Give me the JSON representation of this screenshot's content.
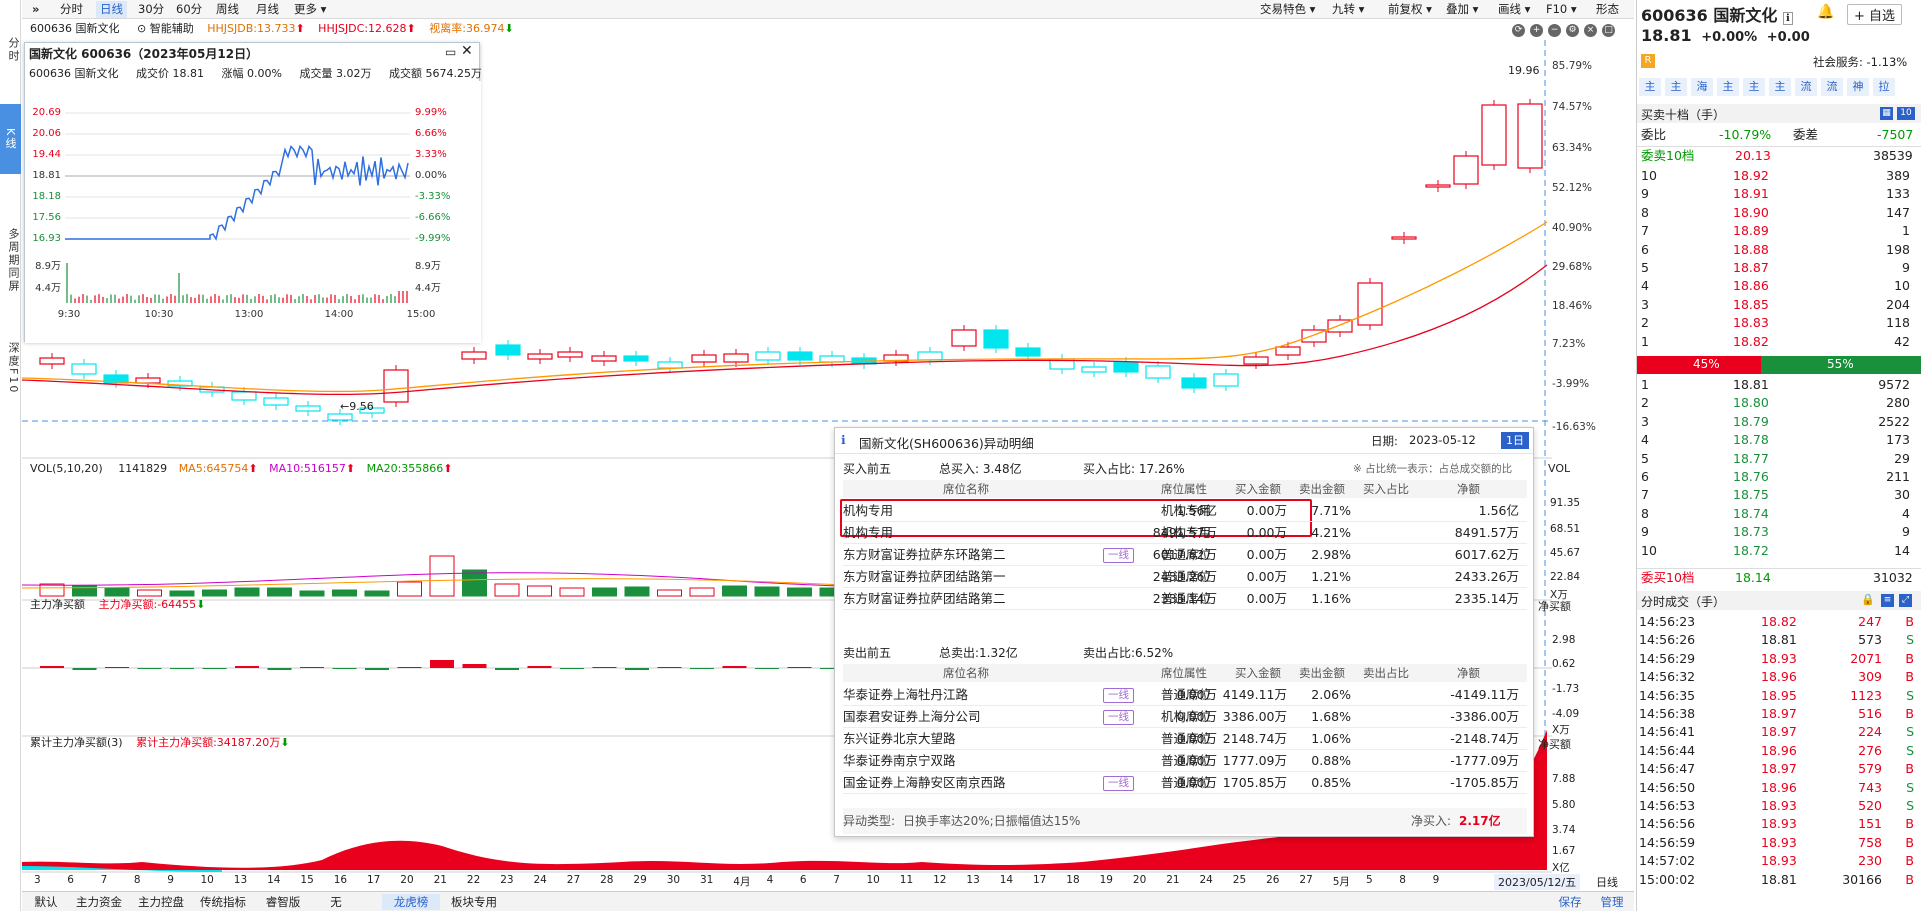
{
  "leftbar": {
    "items": [
      "分时",
      "K线",
      "多周期同屏",
      "深度F10"
    ]
  },
  "toolbar": {
    "menu_icon": "»",
    "tabs": [
      "分时",
      "日线",
      "30分",
      "60分",
      "周线",
      "月线",
      "更多"
    ],
    "right_items": [
      "交易特色",
      "九转",
      "前复权",
      "叠加",
      "画线",
      "F10",
      "形态"
    ]
  },
  "indicator_line": {
    "code": "600636",
    "name": "国新文化",
    "assist": "智能辅助",
    "hhjsjdb": "HHJSJDB:13.733",
    "hhjsjdc": "HHJSJDC:12.628",
    "ratio": "视离率:36.974"
  },
  "price_axis": [
    "85.79%",
    "74.57%",
    "63.34%",
    "52.12%",
    "40.90%",
    "29.68%",
    "18.46%",
    "7.23%",
    "-3.99%",
    "-16.63%"
  ],
  "chart_labels": {
    "high": "19.96",
    "low": "9.56",
    "icon_r": "R",
    "icon_5": "5"
  },
  "vol": {
    "header": "VOL(5,10,20)",
    "value": "1141829",
    "ma5": "MA5:645754",
    "ma10": "MA10:516157",
    "ma20": "MA20:355866",
    "tag": "VOL",
    "axis": [
      "91.35",
      "68.51",
      "45.67",
      "22.84",
      "X万"
    ]
  },
  "main_flow": {
    "header": "主力净买额",
    "value": "主力净买额:-64455",
    "tag": "净买额",
    "axis": [
      "2.98",
      "0.62",
      "-1.73",
      "-4.09",
      "X万"
    ]
  },
  "cum_flow": {
    "header": "累计主力净买额(3)",
    "value": "累计主力净买额:34187.20万",
    "tag": "净买额",
    "axis": [
      "7.88",
      "5.80",
      "3.74",
      "1.67",
      "X亿"
    ]
  },
  "date_axis": [
    "3",
    "6",
    "7",
    "8",
    "9",
    "10",
    "13",
    "14",
    "15",
    "16",
    "17",
    "20",
    "21",
    "22",
    "23",
    "24",
    "27",
    "28",
    "29",
    "30",
    "31",
    "4月",
    "4",
    "6",
    "7",
    "10",
    "11",
    "12",
    "13",
    "14",
    "17",
    "18",
    "19",
    "20",
    "21",
    "24",
    "25",
    "26",
    "27",
    "5月",
    "5",
    "8",
    "9"
  ],
  "date_axis_current": "2023/05/12/五",
  "date_axis_mode": "日线",
  "bottom_tabs": [
    "默认",
    "主力资金",
    "主力控盘",
    "传统指标",
    "睿智版",
    "无",
    "龙虎榜",
    "板块专用"
  ],
  "bottom_right": [
    "保存",
    "管理"
  ],
  "mini": {
    "title": "国新文化 600636（2023年05月12日）",
    "info_code": "600636 国新文化",
    "info_price": "成交价 18.81",
    "info_change": "涨幅 0.00%",
    "info_volume": "成交量 3.02万",
    "info_amount": "成交额 5674.25万",
    "left_axis": [
      "20.69",
      "20.06",
      "19.44",
      "18.81",
      "18.18",
      "17.56",
      "16.93"
    ],
    "right_axis": [
      "9.99%",
      "6.66%",
      "3.33%",
      "0.00%",
      "-3.33%",
      "-6.66%",
      "-9.99%"
    ],
    "vol_axis": [
      "8.9万",
      "4.4万"
    ],
    "time_axis": [
      "9:30",
      "10:30",
      "13:00",
      "14:00",
      "15:00"
    ],
    "line_color": "#2f6fe0"
  },
  "popup": {
    "title": "国新文化(SH600636)异动明细",
    "date_label": "日期:",
    "date": "2023-05-12",
    "period_btn": "1日",
    "buy_section": "买入前五",
    "buy_total": "总买入: 3.48亿",
    "buy_ratio": "买入占比: 17.26%",
    "note": "※ 占比统一表示：占总成交额的比",
    "columns": [
      "席位名称",
      "席位属性",
      "买入金额",
      "卖出金额",
      "买入占比",
      "净额"
    ],
    "buy_rows": [
      {
        "name": "机构专用",
        "tag": "",
        "attr": "机构专用",
        "buy": "1.56亿",
        "sell": "0.00万",
        "ratio": "7.71%",
        "net": "1.56亿"
      },
      {
        "name": "机构专用",
        "tag": "",
        "attr": "机构专用",
        "buy": "8491.57万",
        "sell": "0.00万",
        "ratio": "4.21%",
        "net": "8491.57万"
      },
      {
        "name": "东方财富证券拉萨东环路第二",
        "tag": "一线",
        "attr": "普通席位",
        "buy": "6017.62万",
        "sell": "0.00万",
        "ratio": "2.98%",
        "net": "6017.62万"
      },
      {
        "name": "东方财富证券拉萨团结路第一",
        "tag": "",
        "attr": "普通席位",
        "buy": "2433.26万",
        "sell": "0.00万",
        "ratio": "1.21%",
        "net": "2433.26万"
      },
      {
        "name": "东方财富证券拉萨团结路第二",
        "tag": "",
        "attr": "普通席位",
        "buy": "2335.14万",
        "sell": "0.00万",
        "ratio": "1.16%",
        "net": "2335.14万"
      }
    ],
    "sell_section": "卖出前五",
    "sell_total": "总卖出:1.32亿",
    "sell_ratio": "卖出占比:6.52%",
    "sell_columns": [
      "席位名称",
      "席位属性",
      "买入金额",
      "卖出金额",
      "卖出占比",
      "净额"
    ],
    "sell_rows": [
      {
        "name": "华泰证券上海牡丹江路",
        "tag": "一线",
        "attr": "普通席位",
        "buy": "0.00万",
        "sell": "4149.11万",
        "ratio": "2.06%",
        "net": "-4149.11万"
      },
      {
        "name": "国泰君安证券上海分公司",
        "tag": "一线",
        "attr": "机构席位",
        "buy": "0.00万",
        "sell": "3386.00万",
        "ratio": "1.68%",
        "net": "-3386.00万"
      },
      {
        "name": "东兴证券北京大望路",
        "tag": "",
        "attr": "普通席位",
        "buy": "0.00万",
        "sell": "2148.74万",
        "ratio": "1.06%",
        "net": "-2148.74万"
      },
      {
        "name": "华泰证券南京宁双路",
        "tag": "",
        "attr": "普通席位",
        "buy": "0.00万",
        "sell": "1777.09万",
        "ratio": "0.88%",
        "net": "-1777.09万"
      },
      {
        "name": "国金证券上海静安区南京西路",
        "tag": "一线",
        "attr": "普通席位",
        "buy": "0.00万",
        "sell": "1705.85万",
        "ratio": "0.85%",
        "net": "-1705.85万"
      }
    ],
    "footer_type_label": "异动类型:",
    "footer_type": "日换手率达20%;日振幅值达15%",
    "footer_net_label": "净买入:",
    "footer_net": "2.17亿"
  },
  "right_panel": {
    "code": "600636",
    "name": "国新文化",
    "price": "18.81",
    "change": "+0.00%",
    "change_abs": "+0.00",
    "add_btn": "+ 自选",
    "r_badge": "R",
    "industry": "社会服务: -1.13%",
    "tags": [
      "主",
      "主",
      "海",
      "主",
      "主",
      "主",
      "流",
      "流",
      "神",
      "拉"
    ],
    "book_title": "买卖十档（手）",
    "book_btn": "10",
    "weibi_label": "委比",
    "weibi": "-10.79%",
    "weicha_label": "委差",
    "weicha": "-7507",
    "ask_sum_label": "委卖10档",
    "ask_sum_price": "20.13",
    "ask_sum_vol": "38539",
    "asks": [
      {
        "lvl": "10",
        "price": "18.92",
        "vol": "389"
      },
      {
        "lvl": "9",
        "price": "18.91",
        "vol": "133"
      },
      {
        "lvl": "8",
        "price": "18.90",
        "vol": "147"
      },
      {
        "lvl": "7",
        "price": "18.89",
        "vol": "1"
      },
      {
        "lvl": "6",
        "price": "18.88",
        "vol": "198"
      },
      {
        "lvl": "5",
        "price": "18.87",
        "vol": "9"
      },
      {
        "lvl": "4",
        "price": "18.86",
        "vol": "10"
      },
      {
        "lvl": "3",
        "price": "18.85",
        "vol": "204"
      },
      {
        "lvl": "2",
        "price": "18.83",
        "vol": "118"
      },
      {
        "lvl": "1",
        "price": "18.82",
        "vol": "42"
      }
    ],
    "bar_sell": "45%",
    "bar_buy": "55%",
    "bids": [
      {
        "lvl": "1",
        "price": "18.81",
        "vol": "9572"
      },
      {
        "lvl": "2",
        "price": "18.80",
        "vol": "280"
      },
      {
        "lvl": "3",
        "price": "18.79",
        "vol": "2522"
      },
      {
        "lvl": "4",
        "price": "18.78",
        "vol": "173"
      },
      {
        "lvl": "5",
        "price": "18.77",
        "vol": "29"
      },
      {
        "lvl": "6",
        "price": "18.76",
        "vol": "211"
      },
      {
        "lvl": "7",
        "price": "18.75",
        "vol": "30"
      },
      {
        "lvl": "8",
        "price": "18.74",
        "vol": "4"
      },
      {
        "lvl": "9",
        "price": "18.73",
        "vol": "9"
      },
      {
        "lvl": "10",
        "price": "18.72",
        "vol": "14"
      }
    ],
    "bid_sum_label": "委买10档",
    "bid_sum_price": "18.14",
    "bid_sum_vol": "31032",
    "ticks_title": "分时成交（手）",
    "ticks": [
      {
        "time": "14:56:23",
        "price": "18.82",
        "vol": "247",
        "side": "B",
        "color": "red"
      },
      {
        "time": "14:56:26",
        "price": "18.81",
        "vol": "573",
        "side": "S",
        "color": "black"
      },
      {
        "time": "14:56:29",
        "price": "18.93",
        "vol": "2071",
        "side": "B",
        "color": "red"
      },
      {
        "time": "14:56:32",
        "price": "18.96",
        "vol": "309",
        "side": "B",
        "color": "red"
      },
      {
        "time": "14:56:35",
        "price": "18.95",
        "vol": "1123",
        "side": "S",
        "color": "red"
      },
      {
        "time": "14:56:38",
        "price": "18.97",
        "vol": "516",
        "side": "B",
        "color": "red"
      },
      {
        "time": "14:56:41",
        "price": "18.97",
        "vol": "224",
        "side": "S",
        "color": "red"
      },
      {
        "time": "14:56:44",
        "price": "18.96",
        "vol": "276",
        "side": "S",
        "color": "red"
      },
      {
        "time": "14:56:47",
        "price": "18.97",
        "vol": "579",
        "side": "B",
        "color": "red"
      },
      {
        "time": "14:56:50",
        "price": "18.96",
        "vol": "743",
        "side": "S",
        "color": "red"
      },
      {
        "time": "14:56:53",
        "price": "18.93",
        "vol": "520",
        "side": "S",
        "color": "red"
      },
      {
        "time": "14:56:56",
        "price": "18.93",
        "vol": "151",
        "side": "B",
        "color": "red"
      },
      {
        "time": "14:56:59",
        "price": "18.93",
        "vol": "758",
        "side": "B",
        "color": "red"
      },
      {
        "time": "14:57:02",
        "price": "18.93",
        "vol": "230",
        "side": "B",
        "color": "red"
      },
      {
        "time": "15:00:02",
        "price": "18.81",
        "vol": "30166",
        "side": "B",
        "color": "black"
      }
    ]
  },
  "colors": {
    "up": "#e8001c",
    "down": "#00e5ee",
    "down_fill": "#1a8f3c",
    "accent": "#2a62c9",
    "ma_orange": "#ff9900",
    "ma_red": "#e8001c",
    "highlight": "#e8001c"
  }
}
